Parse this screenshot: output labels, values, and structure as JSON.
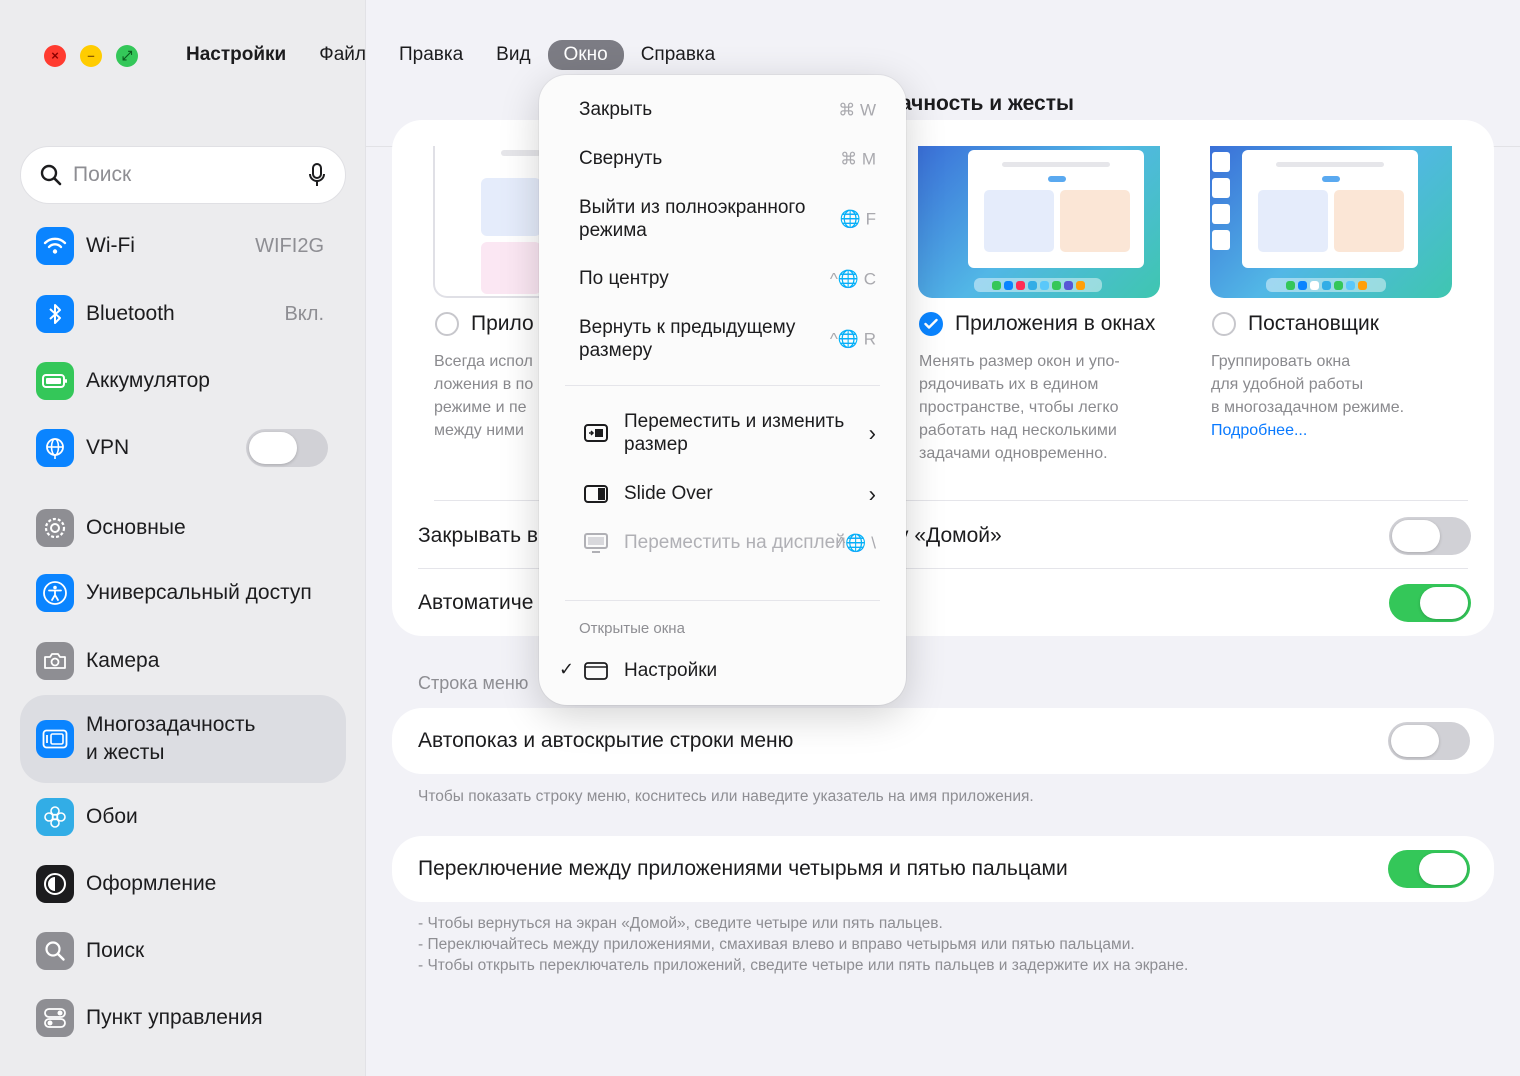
{
  "window": {
    "traffic_lights": [
      "close",
      "minimize",
      "maximize"
    ]
  },
  "menubar": {
    "app": "Настройки",
    "items": [
      "Файл",
      "Правка",
      "Вид",
      "Окно",
      "Справка"
    ],
    "open_item": "Окно"
  },
  "sidebar": {
    "search_placeholder": "Поиск",
    "items": [
      {
        "label": "Wi‑Fi",
        "value": "WIFI2G",
        "icon": "wifi-icon",
        "color": "#0a84ff"
      },
      {
        "label": "Bluetooth",
        "value": "Вкл.",
        "icon": "bluetooth-icon",
        "color": "#0a84ff"
      },
      {
        "label": "Аккумулятор",
        "icon": "battery-icon",
        "color": "#34c759"
      },
      {
        "label": "VPN",
        "icon": "vpn-globe-icon",
        "color": "#0a84ff",
        "toggle": false
      },
      {
        "label": "Основные",
        "icon": "gear-icon",
        "color": "#8e8e93"
      },
      {
        "label": "Универсальный доступ",
        "icon": "accessibility-icon",
        "color": "#0a84ff"
      },
      {
        "label": "Камера",
        "icon": "camera-icon",
        "color": "#8e8e93"
      },
      {
        "label": "Многозадачность\nи жесты",
        "line1": "Многозадачность",
        "line2": "и жесты",
        "icon": "multitasking-icon",
        "color": "#0a84ff",
        "selected": true
      },
      {
        "label": "Обои",
        "icon": "wallpaper-flower-icon",
        "color": "#32ade6"
      },
      {
        "label": "Оформление",
        "icon": "appearance-icon",
        "color": "#1c1c1e"
      },
      {
        "label": "Поиск",
        "icon": "search-icon",
        "color": "#8e8e93"
      },
      {
        "label": "Пункт управления",
        "icon": "control-center-icon",
        "color": "#8e8e93"
      }
    ]
  },
  "main": {
    "title_visible": "ачность и жесты",
    "options": [
      {
        "title": "Прило",
        "selected": false,
        "desc": [
          "Всегда испол",
          "ложения в по",
          "режиме и пе",
          "между ними"
        ]
      },
      {
        "title": "Приложения в окнах",
        "selected": true,
        "desc": [
          "Менять размер окон и упо-",
          "рядочивать их в едином",
          "пространстве, чтобы легко",
          "работать над несколькими",
          "задачами одновременно."
        ]
      },
      {
        "title": "Постановщик",
        "selected": false,
        "desc": [
          "Группировать окна",
          "для удобной работы",
          "в многозадачном режиме."
        ],
        "link": "Подробнее..."
      }
    ],
    "rows": [
      {
        "left": "Закрывать в",
        "right": "у «Домой»",
        "toggle": false
      },
      {
        "left": "Автоматиче",
        "toggle": true
      }
    ],
    "menu_section_label": "Строка меню",
    "menu_row": {
      "label": "Автопоказ и автоскрытие строки меню",
      "toggle": false
    },
    "menu_hint": "Чтобы показать строку меню, коснитесь или наведите указатель на имя приложения.",
    "switch_row": {
      "label": "Переключение между приложениями четырьмя и пятью пальцами",
      "toggle": true
    },
    "switch_hints": [
      "- Чтобы вернуться на экран «Домой», сведите четыре или пять пальцев.",
      "- Переключайтесь между приложениями, смахивая влево и вправо четырьмя или пятью пальцами.",
      "- Чтобы открыть переключатель приложений, сведите четыре или пять пальцев и задержите их на экране."
    ]
  },
  "dropdown": {
    "items": [
      {
        "label": "Закрыть",
        "shortcut": "⌘ W"
      },
      {
        "label": "Свернуть",
        "shortcut": "⌘ M"
      },
      {
        "label": "Выйти из полноэкранного режима",
        "shortcut": "🌐 F"
      },
      {
        "label": "По центру",
        "shortcut": "^🌐 C"
      },
      {
        "label": "Вернуть к предыдущему размеру",
        "shortcut": "^🌐 R"
      },
      {
        "label": "Переместить и изменить размер",
        "icon": "move-resize-icon",
        "submenu": true
      },
      {
        "label": "Slide Over",
        "icon": "slide-over-icon",
        "submenu": true
      },
      {
        "label": "Переместить на дисплей",
        "icon": "display-icon",
        "shortcut": "^🌐 \\",
        "disabled": true
      }
    ],
    "open_windows_label": "Открытые окна",
    "open_windows": [
      {
        "label": "Настройки",
        "checked": true,
        "icon": "window-icon"
      }
    ]
  }
}
